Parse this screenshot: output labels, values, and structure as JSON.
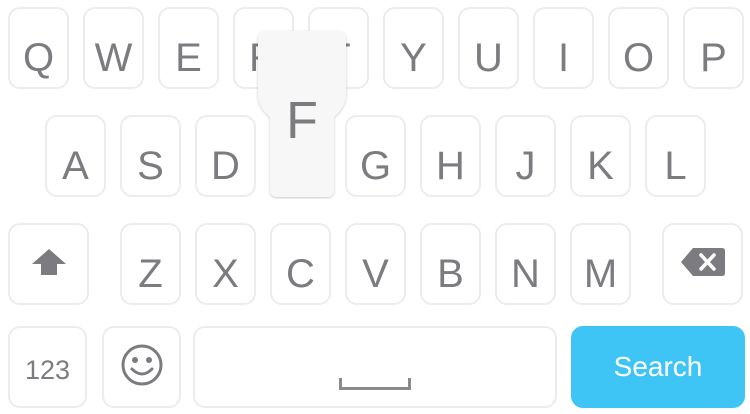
{
  "keyboard": {
    "row1": [
      "Q",
      "W",
      "E",
      "R",
      "T",
      "Y",
      "U",
      "I",
      "O",
      "P"
    ],
    "row2": [
      "A",
      "S",
      "D",
      "F",
      "G",
      "H",
      "J",
      "K",
      "L"
    ],
    "row3": [
      "Z",
      "X",
      "C",
      "V",
      "B",
      "N",
      "M"
    ],
    "popup_key": "F",
    "numbers_label": "123",
    "search_label": "Search",
    "icons": {
      "shift": "shift-arrow-icon",
      "backspace": "backspace-icon",
      "emoji": "smiley-face-icon",
      "space": "space-bar-icon"
    },
    "colors": {
      "search_button": "#3fc5f5",
      "key_border": "#ececec",
      "key_text": "#7c7c80"
    }
  }
}
